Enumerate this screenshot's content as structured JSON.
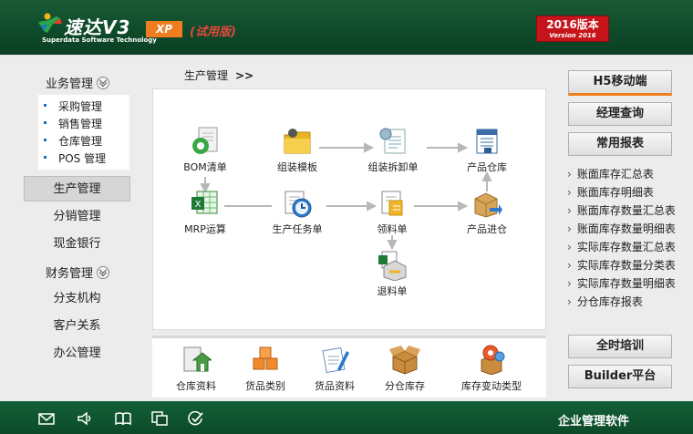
{
  "header": {
    "logo_title": "速达V3",
    "logo_subtitle": "Superdata Software Technology",
    "edition": "XP",
    "trial_label": "(试用版)",
    "year_badge": "2016版本",
    "year_badge_sub": "Version 2016"
  },
  "sidebar": {
    "group_business": "业务管理",
    "sub_items": [
      "采购管理",
      "销售管理",
      "仓库管理",
      "POS 管理"
    ],
    "nav_production": "生产管理",
    "nav_distribution": "分销管理",
    "nav_cash_bank": "现金银行",
    "group_finance": "财务管理",
    "nav_branch": "分支机构",
    "nav_crm": "客户关系",
    "nav_office": "办公管理"
  },
  "main": {
    "breadcrumb": "生产管理",
    "breadcrumb_arrow": ">>",
    "flow": {
      "bom": "BOM清单",
      "assembly_template": "组装模板",
      "assembly_disassembly": "组装拆卸单",
      "product_warehouse": "产品仓库",
      "mrp": "MRP运算",
      "production_task": "生产任务单",
      "material_requisition": "领料单",
      "product_inbound": "产品进仓",
      "material_return": "退料单"
    },
    "bottom": [
      "仓库资料",
      "货品类别",
      "货品资料",
      "分仓库存",
      "库存变动类型"
    ]
  },
  "right": {
    "h5_mobile": "H5移动端",
    "manager_query": "经理查询",
    "common_reports": "常用报表",
    "reports": [
      "账面库存汇总表",
      "账面库存明细表",
      "账面库存数量汇总表",
      "账面库存数量明细表",
      "实际库存数量汇总表",
      "实际库存数量分类表",
      "实际库存数量明细表",
      "分仓库存报表"
    ],
    "training": "全时培训",
    "builder": "Builder平台"
  },
  "footer": {
    "title": "企业管理软件"
  },
  "colors": {
    "header_green": "#0e4a2a",
    "accent_orange": "#f07d1e",
    "badge_red": "#c6141a"
  }
}
